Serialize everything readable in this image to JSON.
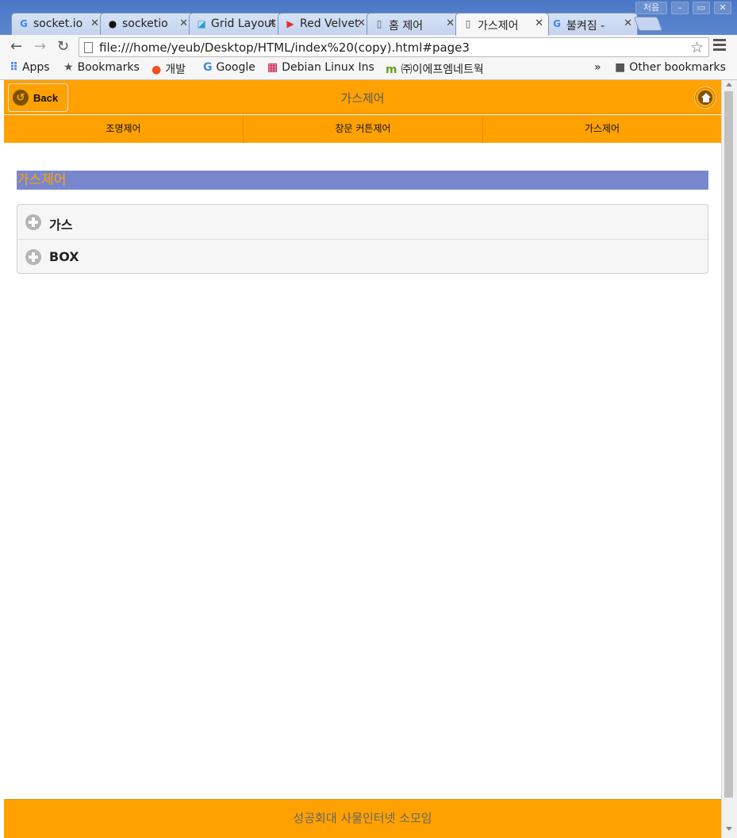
{
  "browser": {
    "tabs": [
      {
        "title": "socket.io",
        "icon": "google-icon",
        "active": false
      },
      {
        "title": "socketio",
        "icon": "github-icon",
        "active": false
      },
      {
        "title": "Grid Layout",
        "icon": "grid-icon",
        "active": false
      },
      {
        "title": "Red Velvet",
        "icon": "youtube-icon",
        "active": false
      },
      {
        "title": "홈 제어",
        "icon": "page-icon",
        "active": false
      },
      {
        "title": "가스제어",
        "icon": "page-icon",
        "active": true
      },
      {
        "title": "불켜짐 -",
        "icon": "google-icon",
        "active": false
      }
    ],
    "window_buttons": [
      "처음",
      "–",
      "▭",
      "✕"
    ],
    "url": "file:///home/yeub/Desktop/HTML/index%20(copy).html#page3",
    "bookmarks": [
      {
        "label": "Apps",
        "icon": "apps-icon"
      },
      {
        "label": "Bookmarks",
        "icon": "star-icon"
      },
      {
        "label": "개발",
        "icon": "dev-icon"
      },
      {
        "label": "Google",
        "icon": "google-icon"
      },
      {
        "label": "Debian Linux Ins",
        "icon": "debian-icon"
      },
      {
        "label": "㈜이에프엠네트웍",
        "icon": "efm-icon"
      }
    ],
    "other_bookmarks": "Other bookmarks",
    "overflow": "»"
  },
  "page": {
    "back_label": "Back",
    "header_title": "가스제어",
    "nav": [
      "조명제어",
      "창문 커튼제어",
      "가스제어"
    ],
    "section_title": "가스제어",
    "collapsibles": [
      "가스",
      "BOX"
    ],
    "footer": "성공회대 사물인터넷 소모임"
  },
  "colors": {
    "accent": "#ffa100",
    "section_bg": "#7887cd",
    "tab_strip": "#4a78c6"
  }
}
